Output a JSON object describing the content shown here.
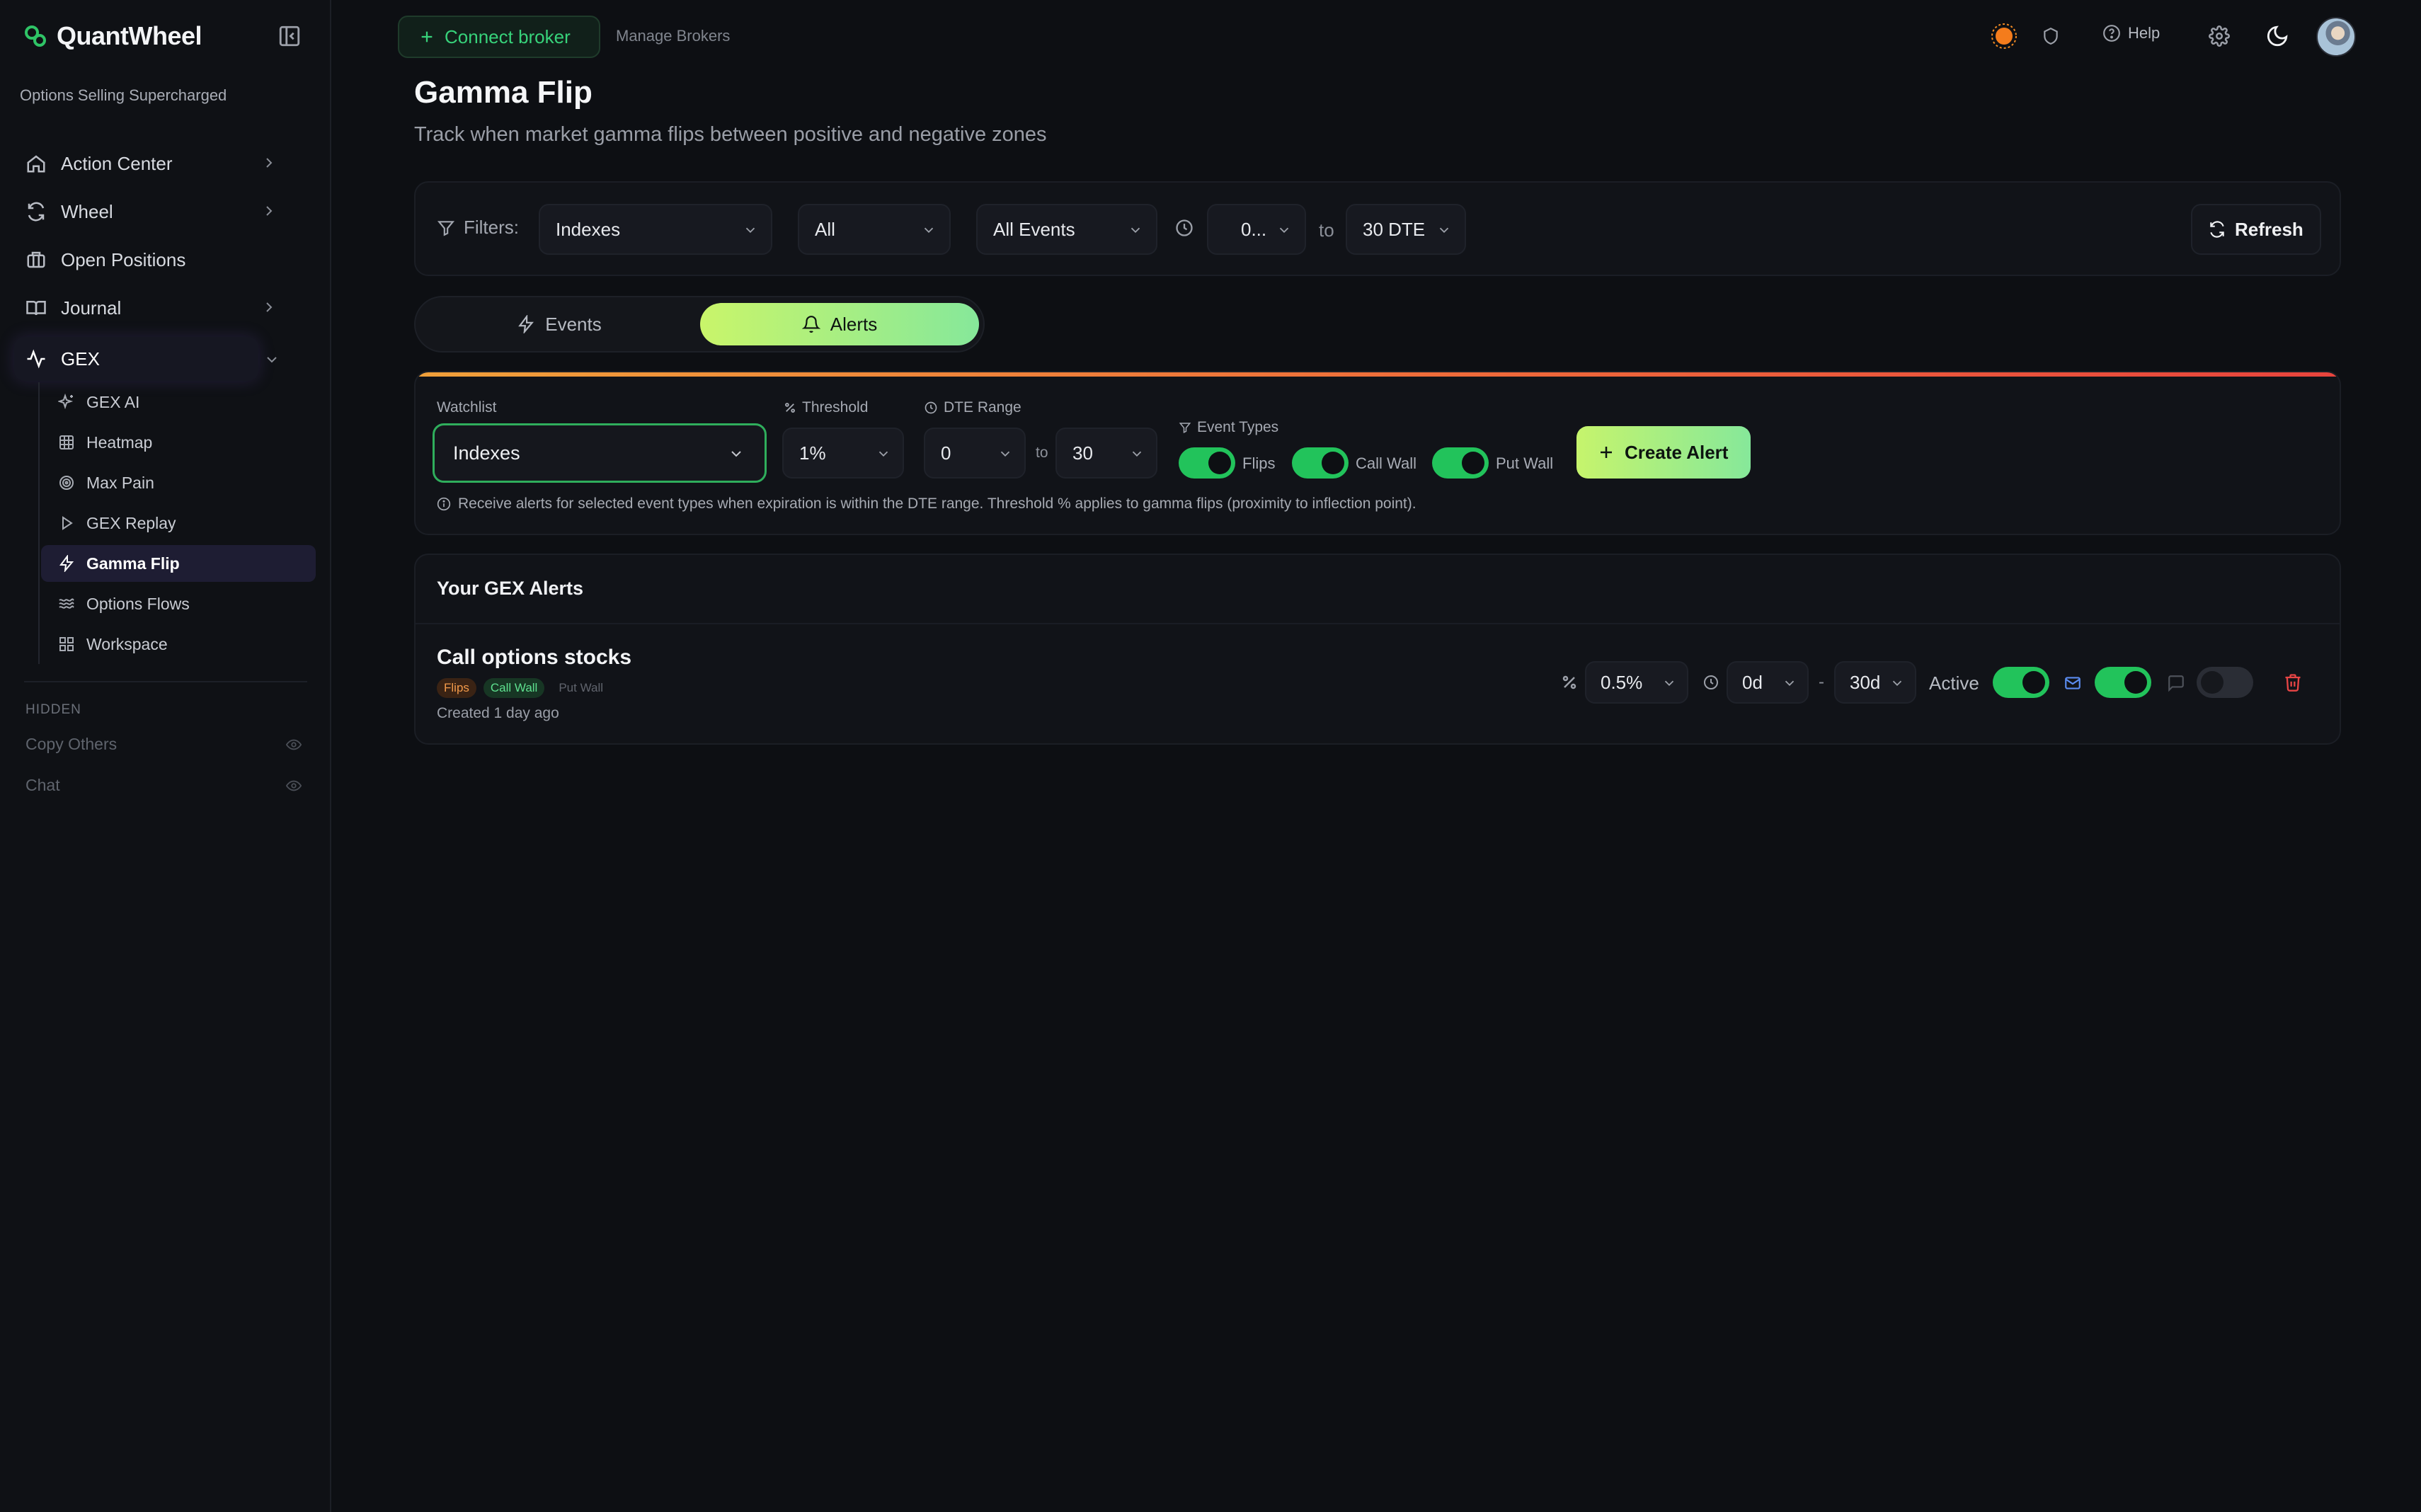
{
  "sidebar": {
    "brand": "QuantWheel",
    "tagline": "Options Selling Supercharged",
    "items": [
      {
        "label": "Action Center"
      },
      {
        "label": "Wheel"
      },
      {
        "label": "Open Positions"
      },
      {
        "label": "Journal"
      },
      {
        "label": "GEX"
      }
    ],
    "sub_items": [
      {
        "label": "GEX AI"
      },
      {
        "label": "Heatmap"
      },
      {
        "label": "Max Pain"
      },
      {
        "label": "GEX Replay"
      },
      {
        "label": "Gamma Flip"
      },
      {
        "label": "Options Flows"
      },
      {
        "label": "Workspace"
      }
    ],
    "hidden_heading": "HIDDEN",
    "hidden_items": [
      {
        "label": "Copy Others"
      },
      {
        "label": "Chat"
      }
    ]
  },
  "topbar": {
    "connect_label": "Connect broker",
    "manage_label": "Manage Brokers",
    "help_label": "Help"
  },
  "page": {
    "title": "Gamma Flip",
    "subtitle": "Track when market gamma flips between positive and negative zones"
  },
  "filters": {
    "label": "Filters:",
    "watchlist": "Indexes",
    "scope": "All",
    "events": "All Events",
    "dte_from": "0...",
    "to": "to",
    "dte_to": "30 DTE",
    "refresh_label": "Refresh"
  },
  "tabs": {
    "events": "Events",
    "alerts": "Alerts"
  },
  "alert_form": {
    "watchlist_label": "Watchlist",
    "watchlist_value": "Indexes",
    "threshold_label": "Threshold",
    "threshold_value": "1%",
    "dte_label": "DTE Range",
    "dte_from": "0",
    "dte_to_word": "to",
    "dte_to": "30",
    "event_types_label": "Event Types",
    "flips_label": "Flips",
    "call_wall_label": "Call Wall",
    "put_wall_label": "Put Wall",
    "create_label": "Create Alert",
    "info": "Receive alerts for selected event types when expiration is within the DTE range. Threshold % applies to gamma flips (proximity to inflection point)."
  },
  "alerts_list": {
    "heading": "Your GEX Alerts",
    "alert": {
      "name": "Call options stocks",
      "tags": [
        "Flips",
        "Call Wall",
        "Put Wall"
      ],
      "created": "Created 1 day ago",
      "threshold": "0.5%",
      "dte_from": "0d",
      "dash": "-",
      "dte_to": "30d",
      "active_label": "Active"
    }
  },
  "colors": {
    "accent_green": "#22c35b",
    "accent_lime": "#c6f46c",
    "danger": "#e84545",
    "background": "#0d0f13"
  }
}
